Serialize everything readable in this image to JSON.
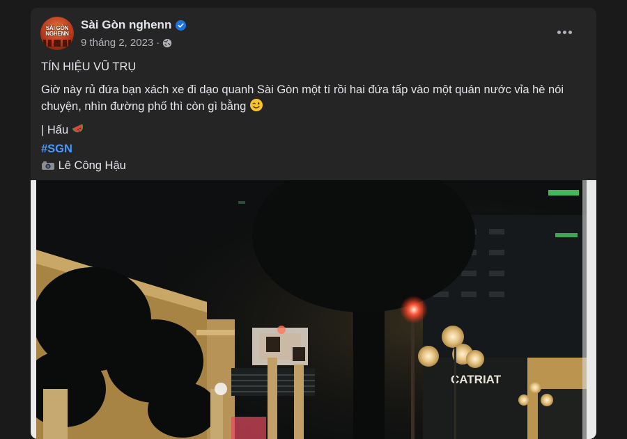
{
  "post": {
    "page_name": "Sài Gòn nghenn",
    "avatar_text": "SÀI GÒN NGHENN",
    "date": "9 tháng 2, 2023",
    "separator": "·",
    "title": "TÍN HIỆU VŨ TRỤ",
    "body": "Giờ này rủ đứa bạn xách xe đi dạo quanh Sài Gòn một tí rồi hai đứa tấp vào một quán nước vỉa hè nói chuyện, nhìn đường phố thì còn gì bằng",
    "author_prefix": "| Hấu",
    "hashtag": "#SGN",
    "photo_credit": "Lê Công Hậu"
  },
  "photo": {
    "sign_text": "CATRIAT"
  },
  "icons": {
    "verified": "verified-badge-icon",
    "privacy": "globe-icon",
    "more": "more-options-icon",
    "wink": "winking-face-emoji",
    "watermelon": "watermelon-emoji",
    "camera": "camera-emoji"
  },
  "colors": {
    "card": "#252526",
    "text": "#e4e6eb",
    "muted": "#b0b3b8",
    "hashtag": "#4599ff",
    "verified": "#1b74e4"
  }
}
